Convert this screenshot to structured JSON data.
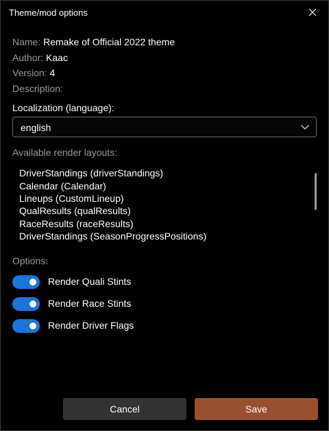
{
  "window": {
    "title": "Theme/mod options"
  },
  "info": {
    "name_label": "Name:",
    "name_value": "Remake of Official 2022 theme",
    "author_label": "Author:",
    "author_value": "Kaac",
    "version_label": "Version:",
    "version_value": "4",
    "description_label": "Description:"
  },
  "localization": {
    "label": "Localization (language):",
    "selected": "english"
  },
  "layouts": {
    "label": "Available render layouts:",
    "items": [
      "DriverStandings (driverStandings)",
      "Calendar (Calendar)",
      "Lineups (CustomLineup)",
      "QualResults (qualResults)",
      "RaceResults (raceResults)",
      "DriverStandings (SeasonProgressPositions)"
    ]
  },
  "options": {
    "label": "Options:",
    "toggles": [
      {
        "label": "Render Quali Stints",
        "on": true
      },
      {
        "label": "Render Race Stints",
        "on": true
      },
      {
        "label": "Render Driver Flags",
        "on": true
      }
    ]
  },
  "buttons": {
    "cancel": "Cancel",
    "save": "Save"
  },
  "colors": {
    "accent_toggle": "#1b74d9",
    "save_button": "#9a4f2e",
    "cancel_button": "#333333",
    "background": "#000000",
    "muted_text": "#9a9a9a"
  },
  "icons": {
    "close": "close-icon",
    "dropdown": "chevron-down-icon"
  }
}
